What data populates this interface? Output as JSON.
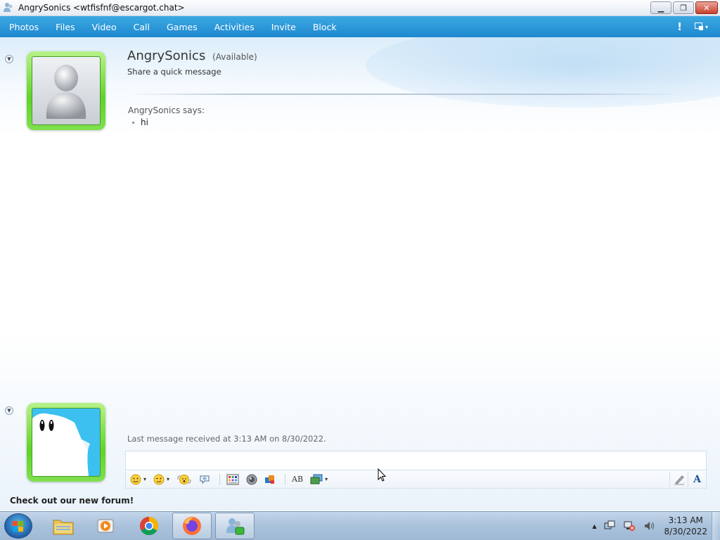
{
  "window": {
    "title": "AngrySonics <wtfisfnf@escargot.chat>",
    "minimize_glyph": "▁",
    "maximize_glyph": "❐",
    "close_glyph": "✕"
  },
  "menu": {
    "items": [
      "Photos",
      "Files",
      "Video",
      "Call",
      "Games",
      "Activities",
      "Invite",
      "Block"
    ],
    "alert_glyph": "!",
    "layout_caret": "▾"
  },
  "contact": {
    "name": "AngrySonics",
    "status": "(Available)",
    "personal_message": "Share a quick message"
  },
  "conversation": {
    "sender_line": "AngrySonics says:",
    "messages": [
      "hi"
    ],
    "last_message_info": "Last message received at 3:13 AM on 8/30/2022."
  },
  "input": {
    "value": ""
  },
  "toolbar": {
    "items": [
      "emoticon-icon",
      "wink-icon",
      "nudge-icon",
      "voice-clip-icon",
      "background-icon",
      "wink-animation-icon",
      "games-icon",
      "spellcheck-icon",
      "send-file-icon",
      "handwriting-icon",
      "font-icon"
    ],
    "caret": "▾",
    "font_glyph": "A",
    "spell_glyph": "AB"
  },
  "footer": {
    "promo": "Check out our new forum!"
  },
  "taskbar": {
    "apps": [
      "file-explorer-icon",
      "media-player-icon",
      "chrome-icon",
      "firefox-icon",
      "messenger-icon"
    ],
    "tray_caret": "▲",
    "time": "3:13 AM",
    "date": "8/30/2022"
  },
  "colors": {
    "menubar": "#2a98d9",
    "avatar_frame": "#5fd329",
    "taskbar": "#a9c2dc"
  }
}
